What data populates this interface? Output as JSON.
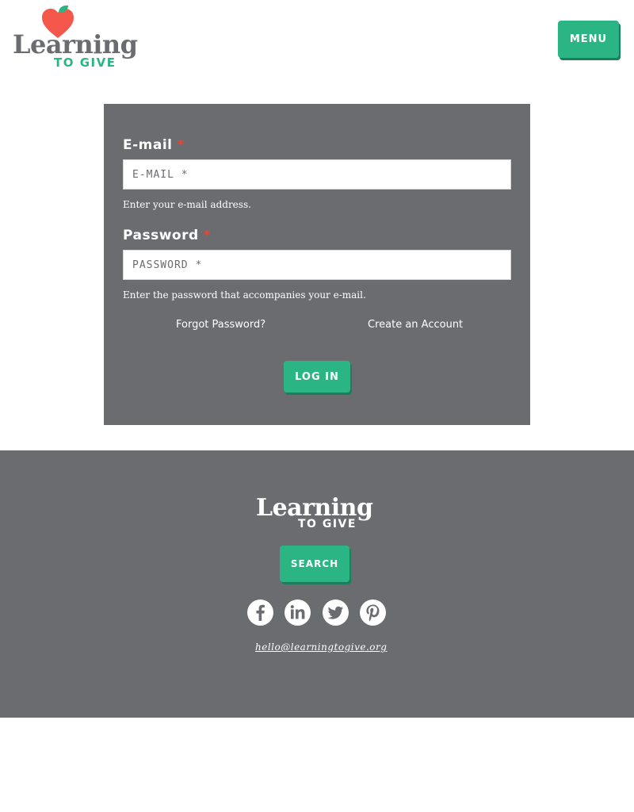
{
  "brand": {
    "logo_word": "Learning",
    "logo_sub": "TO GIVE",
    "colors": {
      "green": "#2bb584",
      "gray": "#6b6c70",
      "heart": "#f4574a",
      "leaf": "#2bb584",
      "required": "#e0483b"
    }
  },
  "header": {
    "menu_label": "MENU"
  },
  "login": {
    "email": {
      "label": "E-mail",
      "required_mark": "*",
      "placeholder": "E-MAIL *",
      "value": "",
      "help": "Enter your e-mail address."
    },
    "password": {
      "label": "Password",
      "required_mark": "*",
      "placeholder": "PASSWORD *",
      "value": "",
      "help": "Enter the password that accompanies your e-mail."
    },
    "forgot_label": "Forgot Password?",
    "create_label": "Create an Account",
    "submit_label": "LOG IN"
  },
  "footer": {
    "logo_word": "Learning",
    "logo_sub": "TO GIVE",
    "search_label": "SEARCH",
    "social": [
      "facebook-icon",
      "linkedin-icon",
      "twitter-icon",
      "pinterest-icon"
    ],
    "email": "hello@learningtogive.org"
  }
}
